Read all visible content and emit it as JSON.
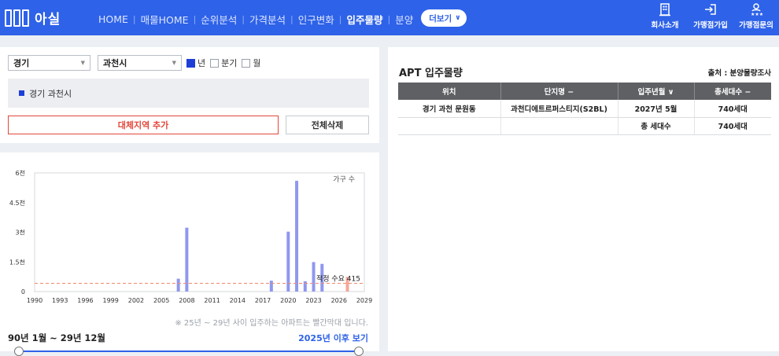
{
  "header": {
    "brand": "아실",
    "nav": [
      "HOME",
      "매물HOME",
      "순위분석",
      "가격분석",
      "인구변화",
      "입주물량",
      "분양"
    ],
    "active_nav": "입주물량",
    "more_label": "더보기",
    "links": [
      {
        "label": "회사소개",
        "icon": "building-icon"
      },
      {
        "label": "가맹점가입",
        "icon": "signin-icon"
      },
      {
        "label": "가맹점문의",
        "icon": "person-stars-icon"
      }
    ]
  },
  "filters": {
    "region1": "경기",
    "region2": "과천시",
    "period_options": [
      {
        "label": "년",
        "checked": true
      },
      {
        "label": "분기",
        "checked": false
      },
      {
        "label": "월",
        "checked": false
      }
    ]
  },
  "selected_region": "경기 과천시",
  "buttons": {
    "add_region": "대체지역 추가",
    "delete_all": "전체삭제"
  },
  "chart_data": {
    "type": "bar",
    "legend": "가구 수",
    "ylabel_ticks": [
      "0",
      "1.5천",
      "3천",
      "4.5천",
      "6천"
    ],
    "xlabel_ticks": [
      "1990",
      "1993",
      "1996",
      "1999",
      "2002",
      "2005",
      "2008",
      "2011",
      "2014",
      "2017",
      "2020",
      "2023",
      "2026",
      "2029"
    ],
    "ylim": [
      0,
      6000
    ],
    "xlim": [
      1990,
      2029
    ],
    "series": [
      {
        "x": [
          2007,
          2008,
          2018,
          2020,
          2021,
          2022,
          2023,
          2024,
          2027
        ],
        "y": [
          650,
          3230,
          550,
          3030,
          5600,
          520,
          1490,
          1400,
          740
        ],
        "colors": [
          "#8f98ee",
          "#8f98ee",
          "#8f98ee",
          "#8f98ee",
          "#8f98ee",
          "#8f98ee",
          "#8f98ee",
          "#8f98ee",
          "#f5a79a"
        ]
      }
    ],
    "reference_line": {
      "label": "적정 수요",
      "value": 415,
      "value_label": "415",
      "color": "#f08a6c"
    },
    "note": "※ 25년 ~ 29년 사이 입주하는 아파트는 빨간막대 입니다."
  },
  "range_label": "90년 1월 ~ 29년 12월",
  "since_link": "2025년 이후 보기",
  "apt_table": {
    "title": "APT 입주물량",
    "source": "출처 : 분양물량조사",
    "columns": [
      "위치",
      "단지명 −",
      "입주년월 ∨",
      "총세대수 −"
    ],
    "rows": [
      [
        "경기 과천 문원동",
        "과천디에트르퍼스티지(S2BL)",
        "2027년 5월",
        "740세대"
      ],
      [
        "",
        "",
        "총 세대수",
        "740세대"
      ]
    ]
  },
  "colors": {
    "brand_blue": "#2e62e8",
    "add_red": "#e2473a",
    "bar_blue": "#8f98ee",
    "bar_red": "#f5a79a"
  }
}
